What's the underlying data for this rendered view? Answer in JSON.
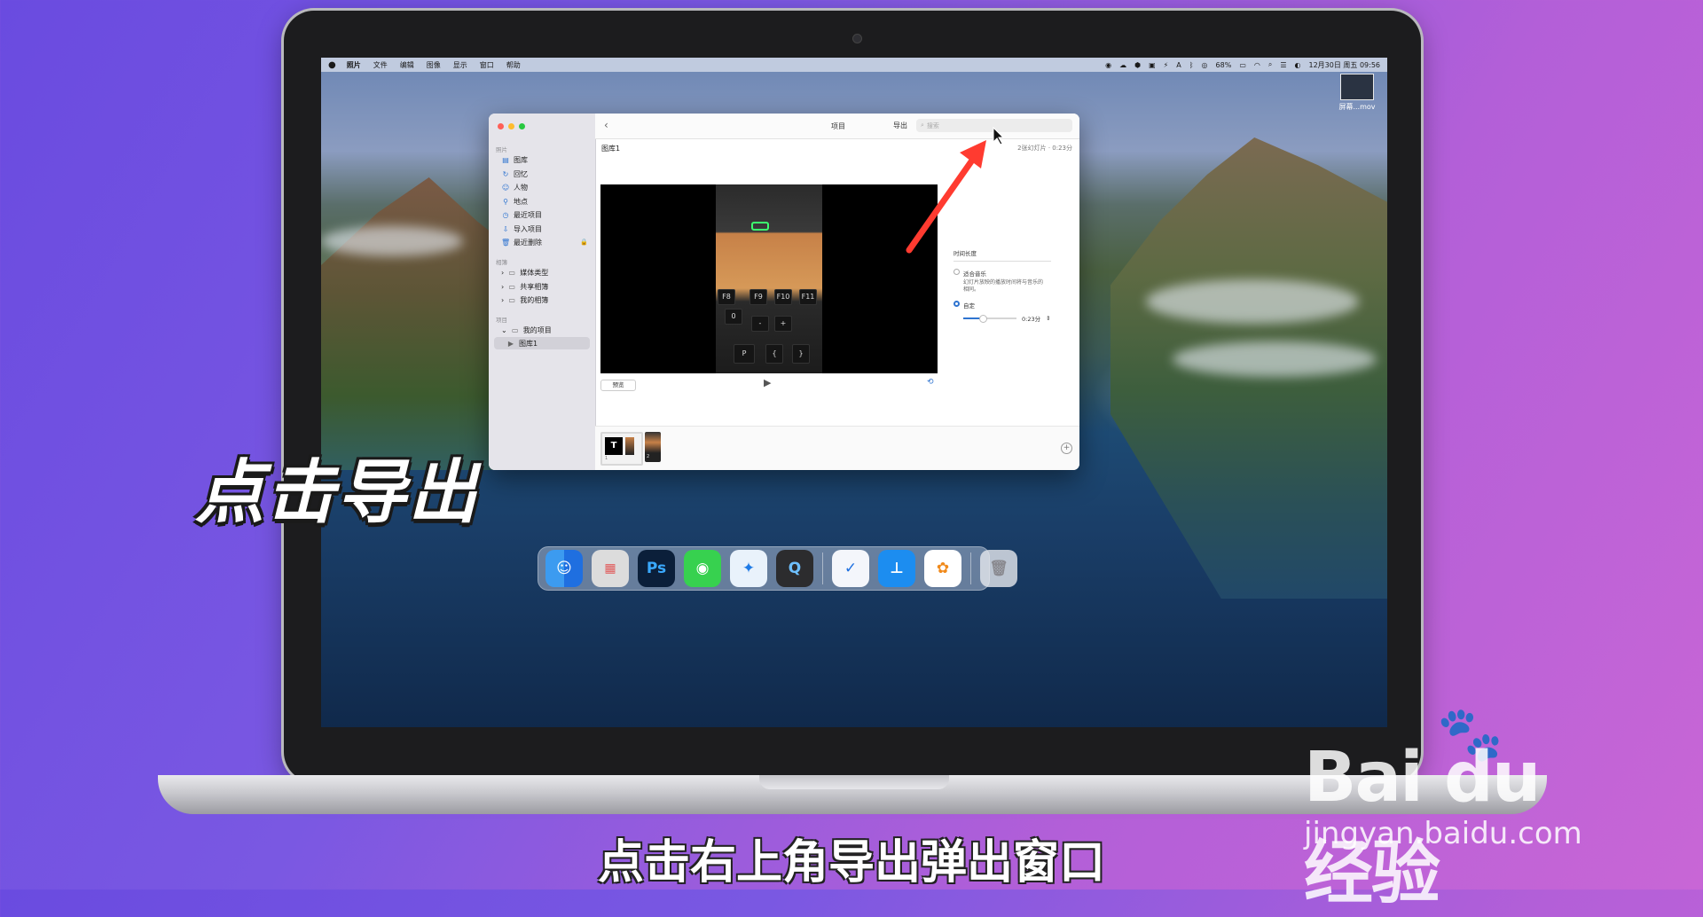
{
  "menubar": {
    "app_name": "照片",
    "items": [
      "文件",
      "编辑",
      "图像",
      "显示",
      "窗口",
      "帮助"
    ],
    "status_text": "A",
    "battery": "68%",
    "datetime": "12月30日 周五 09:56"
  },
  "desktop_file": {
    "name": "屏幕...mov"
  },
  "window": {
    "toolbar": {
      "title": "项目",
      "export_label": "导出",
      "search_placeholder": "搜索"
    },
    "sidebar": {
      "sections": [
        {
          "label": "照片",
          "items": [
            {
              "label": "图库",
              "icon": "photos-icon"
            },
            {
              "label": "回忆",
              "icon": "memories-icon"
            },
            {
              "label": "人物",
              "icon": "people-icon"
            },
            {
              "label": "地点",
              "icon": "places-icon"
            },
            {
              "label": "最近项目",
              "icon": "recents-icon"
            },
            {
              "label": "导入项目",
              "icon": "imports-icon"
            },
            {
              "label": "最近删除",
              "icon": "trash-icon"
            }
          ]
        },
        {
          "label": "相簿",
          "items": [
            {
              "label": "媒体类型",
              "icon": "folder-icon"
            },
            {
              "label": "共享相簿",
              "icon": "folder-icon"
            },
            {
              "label": "我的相簿",
              "icon": "folder-icon"
            }
          ]
        },
        {
          "label": "项目",
          "items": [
            {
              "label": "我的项目",
              "icon": "folder-icon"
            },
            {
              "label": "图库1",
              "icon": "slideshow-icon"
            }
          ]
        }
      ]
    },
    "content": {
      "library_name": "图库1",
      "library_meta": "2张幻灯片 · 0:23分",
      "preview_button": "预览",
      "keys": [
        "F8",
        "F9",
        "F10",
        "F11",
        "0",
        "-",
        "+",
        "P",
        "{",
        "}"
      ],
      "panel": {
        "title": "时间长度",
        "option_fit": "适合音乐",
        "option_fit_desc": "幻灯片放映的播放时间将与音乐的相同。",
        "option_custom": "自定",
        "duration": "0:23分"
      },
      "thumbnails": [
        {
          "index": "1",
          "glyph": "T"
        },
        {
          "index": "2"
        }
      ]
    }
  },
  "dock": {
    "apps": [
      "Finder",
      "Launchpad",
      "Ps",
      "Messages",
      "Safari",
      "QuickTime",
      "Sketch",
      "Keynote",
      "Photos",
      "Trash"
    ]
  },
  "overlay": {
    "big_caption": "点击导出",
    "subtitle": "点击右上角导出弹出窗口",
    "watermark_logo": "Bai du 经验",
    "watermark_url": "jingyan.baidu.com"
  },
  "colors": {
    "accent": "#2f74d0",
    "arrow": "#ff3b30",
    "caption": "#ffffff"
  }
}
